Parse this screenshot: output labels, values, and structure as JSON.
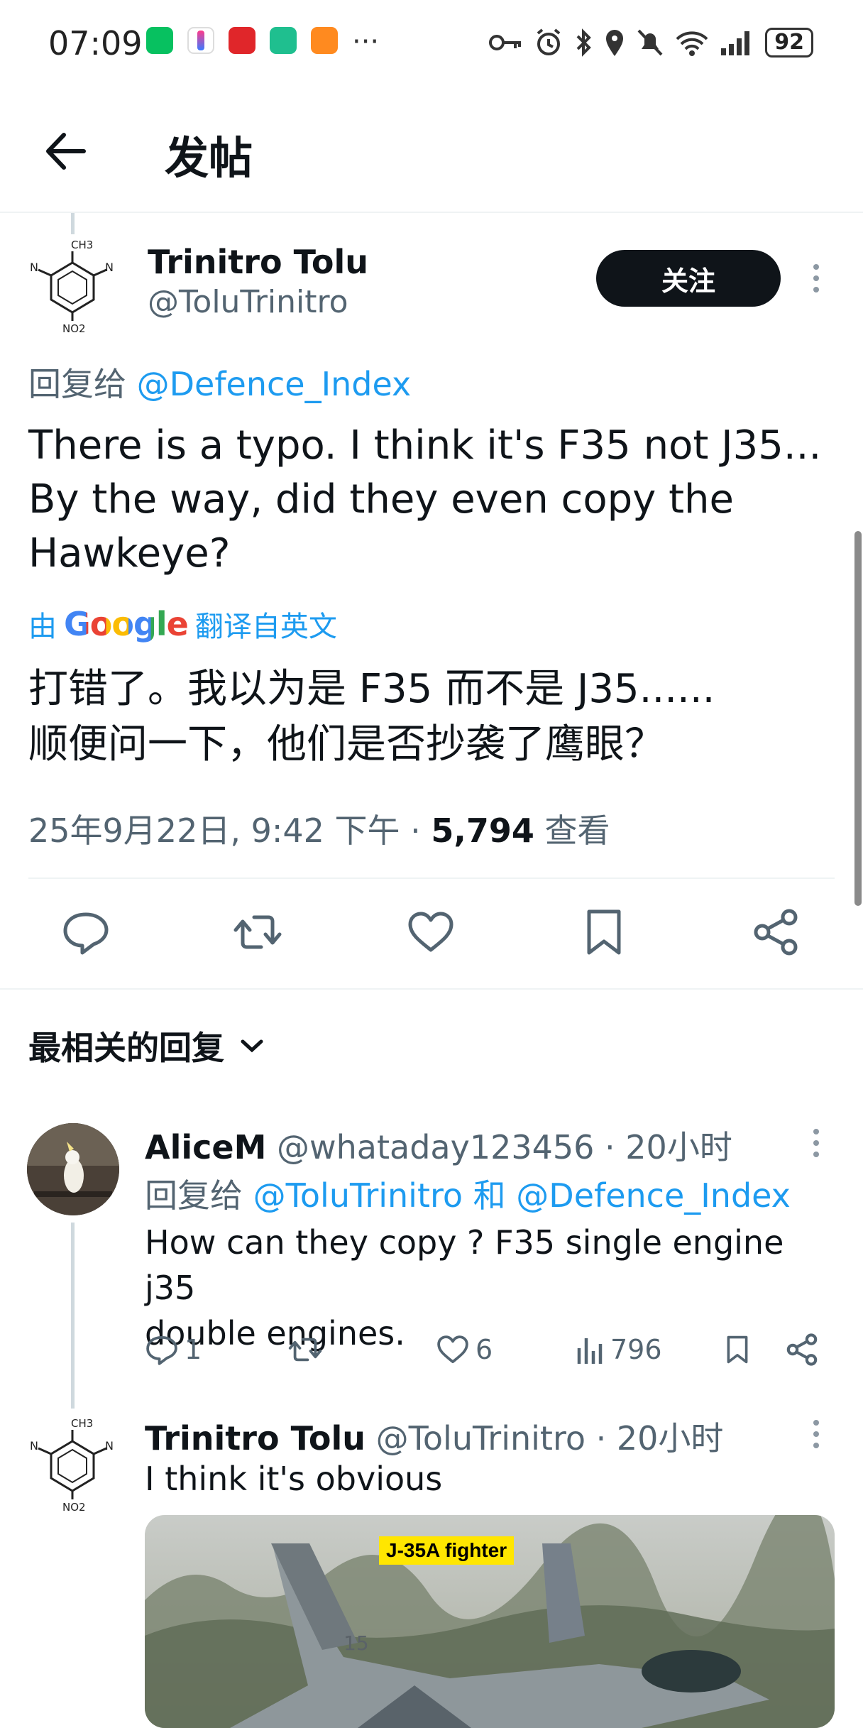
{
  "status_bar": {
    "time": "07:09",
    "more": "···",
    "battery": "92",
    "network": "6"
  },
  "header": {
    "title": "发帖"
  },
  "main_tweet": {
    "name": "Trinitro Tolu",
    "handle": "@ToluTrinitro",
    "follow_label": "关注",
    "reply_prefix": "回复给",
    "reply_to": "@Defence_Index",
    "text": "There is a typo. I think it's F35 not J35...\nBy the way, did they even copy the\nHawkeye?",
    "translate_prefix": "由",
    "translate_brand": "Google",
    "translate_suffix": "翻译自英文",
    "translated_text": "打错了。我以为是 F35 而不是 J35......\n顺便问一下，他们是否抄袭了鹰眼？",
    "timestamp": "25年9月22日, 9:42 下午 · ",
    "views": "5,794",
    "views_label": " 查看"
  },
  "avatar_label": {
    "top": "CH3",
    "left": "N",
    "right": "N",
    "bottom": "NO2"
  },
  "sort": {
    "label": "最相关的回复"
  },
  "replies": [
    {
      "name": "AliceM",
      "handle": "@whataday123456",
      "time": " · 20小时",
      "reply_prefix": "回复给 ",
      "reply_to_1": "@ToluTrinitro",
      "reply_joiner": " 和 ",
      "reply_to_2": "@Defence_Index",
      "text": "How can they copy ? F35 single engine j35\ndouble engines.",
      "reply_count": "1",
      "like_count": "6",
      "view_count": "796"
    },
    {
      "name": "Trinitro Tolu",
      "handle": "@ToluTrinitro",
      "time": " · 20小时",
      "text": "I think it's obvious",
      "media_caption": "J-35A fighter"
    }
  ],
  "colors": {
    "link": "#1d9bf0",
    "text": "#0f1419",
    "secondary": "#536471",
    "follow_bg": "#0f1419"
  }
}
